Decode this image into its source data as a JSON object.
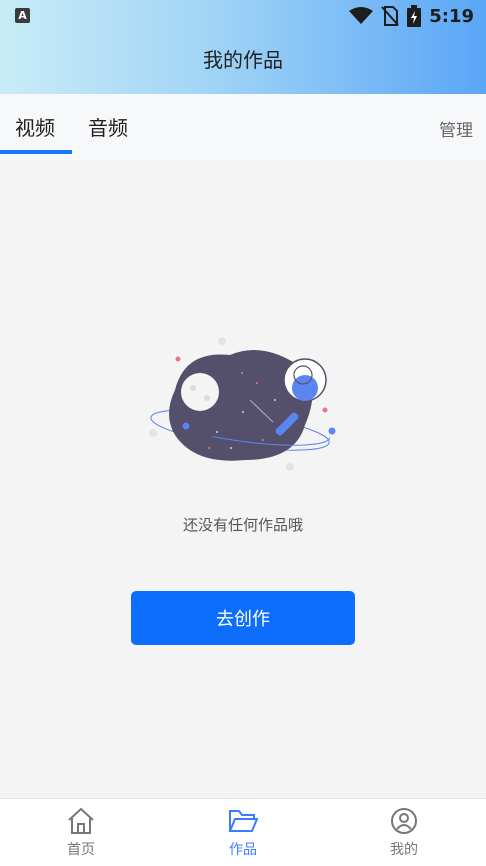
{
  "status_bar": {
    "left_icon_label": "A",
    "time": "5:19"
  },
  "header": {
    "title": "我的作品"
  },
  "tabs": [
    {
      "label": "视频",
      "active": true
    },
    {
      "label": "音频",
      "active": false
    }
  ],
  "manage_label": "管理",
  "empty_state": {
    "message": "还没有任何作品哦"
  },
  "create_button_label": "去创作",
  "bottom_nav": {
    "items": [
      {
        "label": "首页",
        "icon": "home-icon",
        "active": false
      },
      {
        "label": "作品",
        "icon": "folder-icon",
        "active": true
      },
      {
        "label": "我的",
        "icon": "user-icon",
        "active": false
      }
    ]
  },
  "colors": {
    "accent": "#1677ff",
    "button": "#0d6efd",
    "active_nav": "#3b7cff"
  }
}
